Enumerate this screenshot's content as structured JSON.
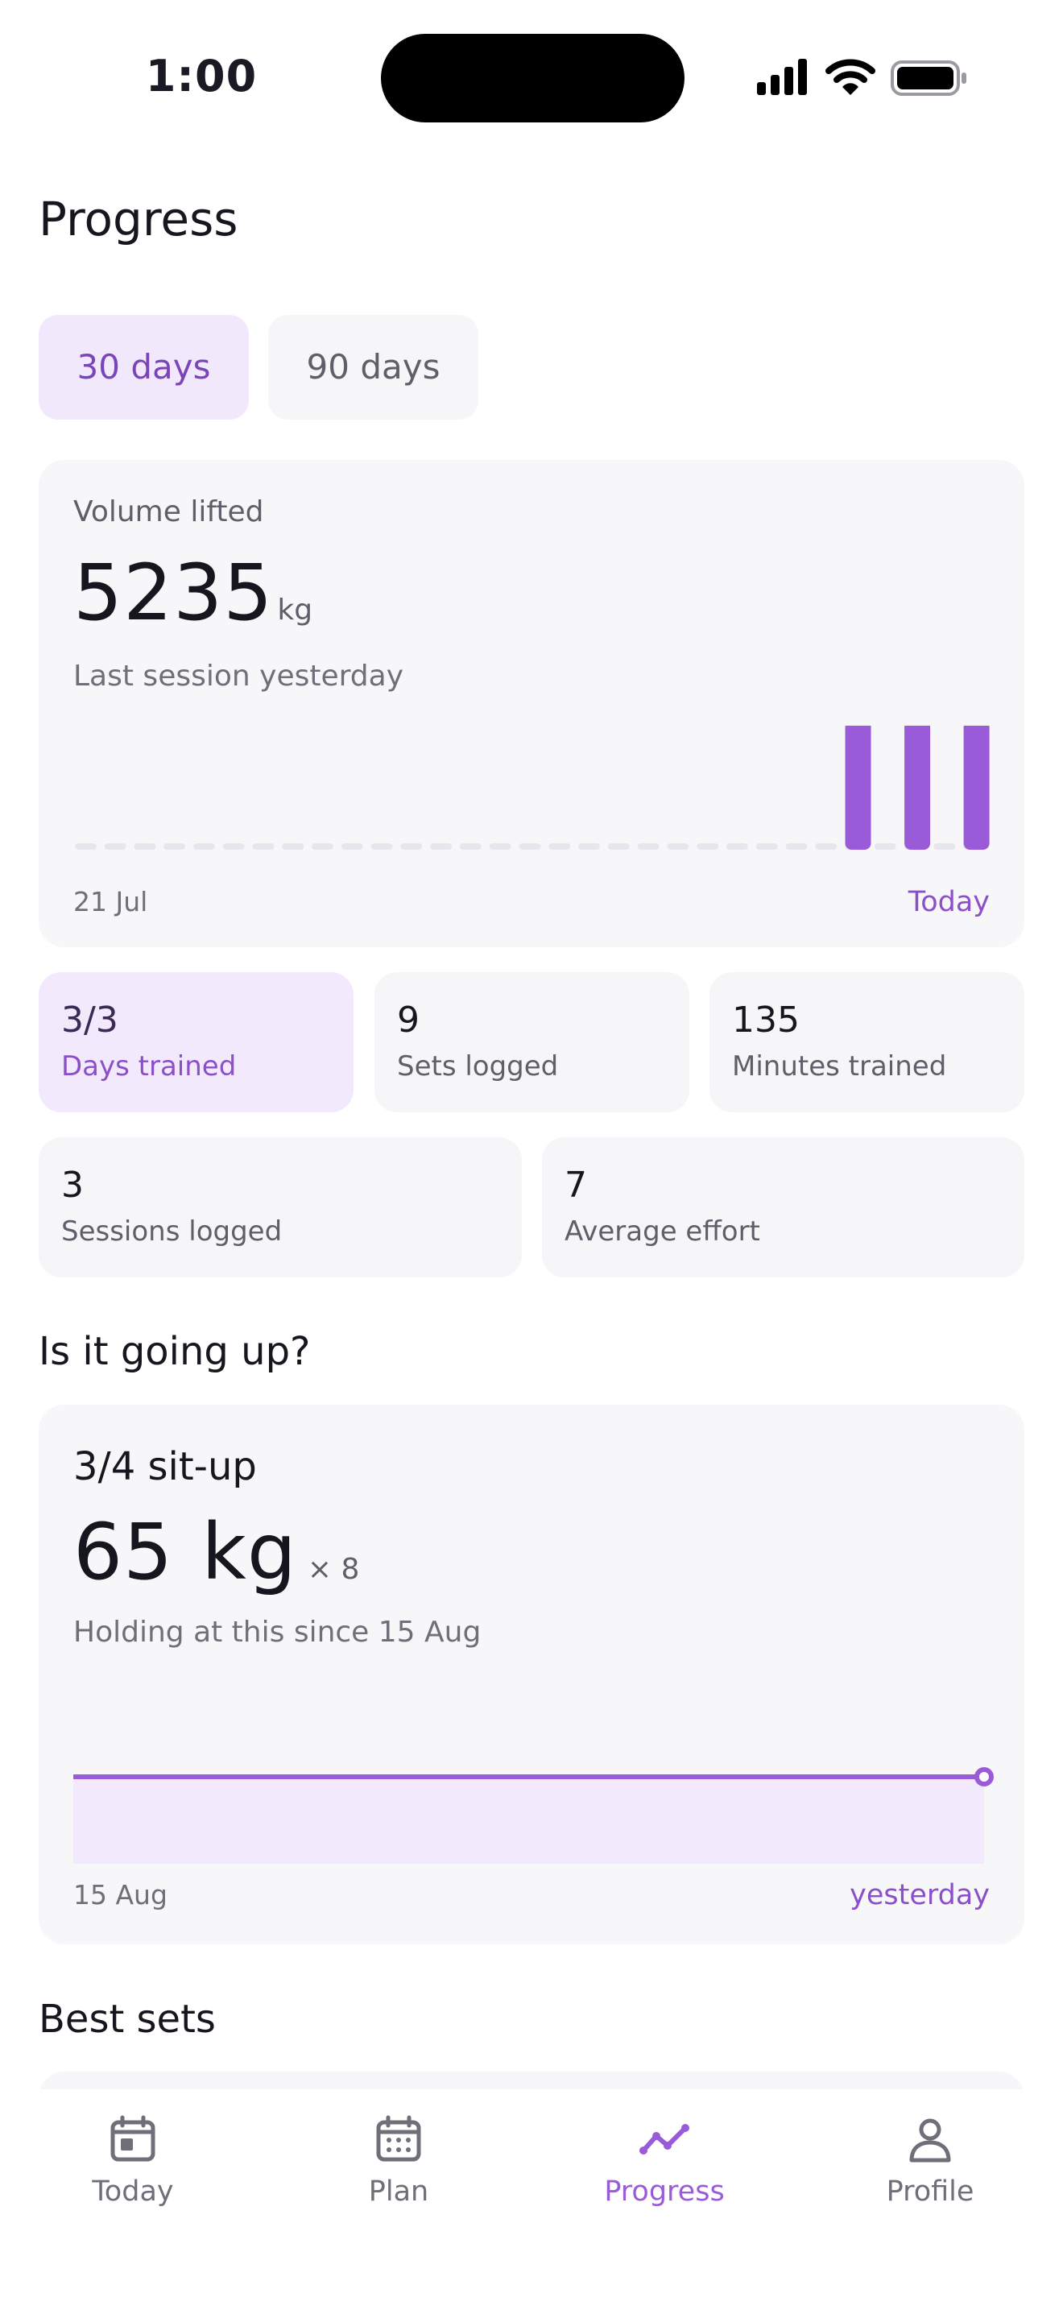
{
  "status_bar": {
    "time": "1:00"
  },
  "page_title": "Progress",
  "range_tabs": [
    {
      "label": "30 days",
      "selected": true
    },
    {
      "label": "90 days",
      "selected": false
    }
  ],
  "volume": {
    "label": "Volume lifted",
    "value": "5235",
    "unit": "kg",
    "subtitle": "Last session yesterday",
    "start_label": "21 Jul",
    "end_label": "Today"
  },
  "stats_row1": [
    {
      "value": "3/3",
      "label": "Days trained",
      "highlight": true
    },
    {
      "value": "9",
      "label": "Sets logged",
      "highlight": false
    },
    {
      "value": "135",
      "label": "Minutes trained",
      "highlight": false
    }
  ],
  "stats_row2": [
    {
      "value": "3",
      "label": "Sessions logged"
    },
    {
      "value": "7",
      "label": "Average effort"
    }
  ],
  "section_trend": "Is it going up?",
  "exercise": {
    "name": "3/4 sit-up",
    "weight": "65",
    "unit": "kg",
    "reps": "× 8",
    "note": "Holding at this since 15 Aug",
    "start_label": "15 Aug",
    "end_label": "yesterday"
  },
  "section_best": "Best sets",
  "tabbar": [
    {
      "label": "Today",
      "icon": "calendar-today-icon",
      "active": false
    },
    {
      "label": "Plan",
      "icon": "calendar-grid-icon",
      "active": false
    },
    {
      "label": "Progress",
      "icon": "trend-line-icon",
      "active": true
    },
    {
      "label": "Profile",
      "icon": "person-icon",
      "active": false
    }
  ],
  "colors": {
    "accent": "#9a5bd9",
    "accent_light": "#f2eafc",
    "card_bg": "#f7f7f9",
    "text": "#16161f"
  },
  "chart_data": [
    {
      "type": "bar",
      "x_range": [
        "21 Jul",
        "Today"
      ],
      "days": 30,
      "values_by_day": [
        0,
        0,
        0,
        0,
        0,
        0,
        0,
        0,
        0,
        0,
        0,
        0,
        0,
        0,
        0,
        0,
        0,
        0,
        0,
        0,
        0,
        0,
        0,
        0,
        0,
        0,
        1,
        0,
        1,
        0,
        1
      ],
      "note": "three sessions in last days, bars equal height"
    },
    {
      "type": "line",
      "x_range": [
        "15 Aug",
        "yesterday"
      ],
      "series": [
        {
          "values": [
            65,
            65
          ]
        }
      ]
    }
  ]
}
